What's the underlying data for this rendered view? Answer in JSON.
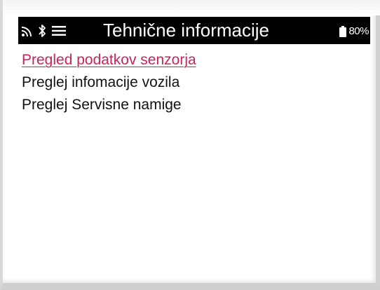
{
  "colors": {
    "header_bg": "#000000",
    "header_text": "#ffffff",
    "selected_item": "#c8245a",
    "item_text": "#111111",
    "background": "#ffffff"
  },
  "status_bar": {
    "title": "Tehnične informacije",
    "icons": [
      "wifi-icon",
      "bluetooth-icon",
      "menu-icon",
      "battery-icon"
    ],
    "battery_percent": "80%"
  },
  "menu": {
    "selected_index": 0,
    "items": [
      {
        "label": "Pregled podatkov senzorja"
      },
      {
        "label": "Preglej infomacije vozila"
      },
      {
        "label": "Preglej Servisne namige"
      }
    ]
  }
}
